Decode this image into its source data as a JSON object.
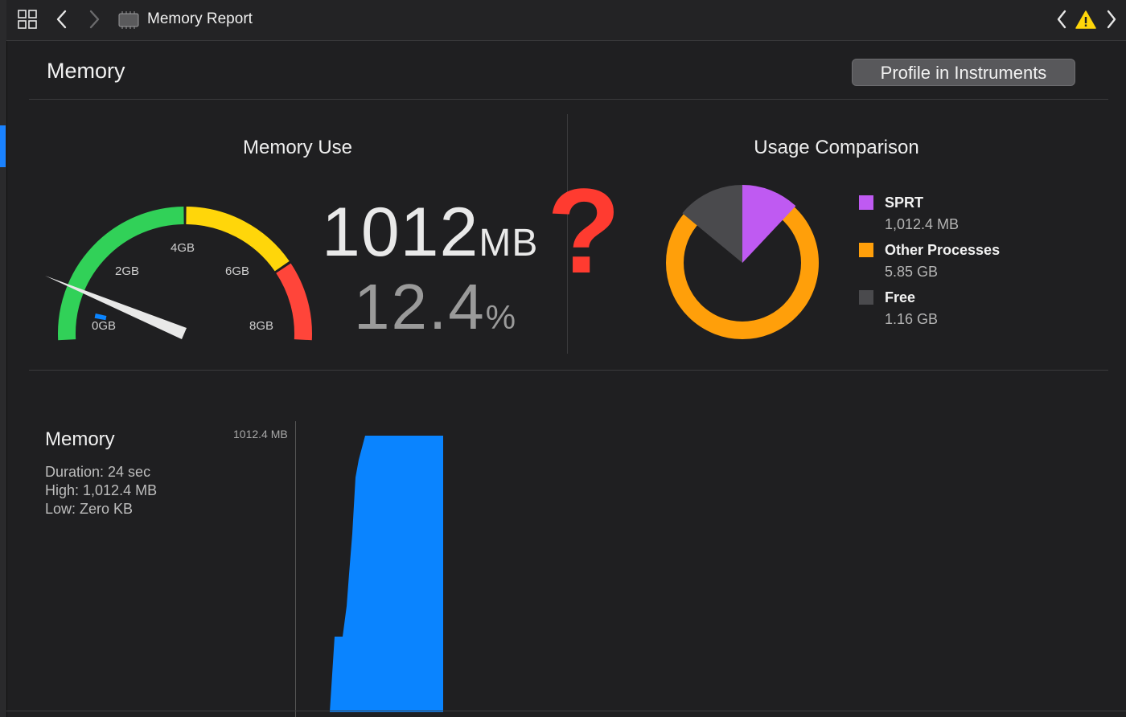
{
  "toolbar": {
    "title": "Memory Report"
  },
  "header": {
    "title": "Memory",
    "profile_button": "Profile in Instruments"
  },
  "memory_use": {
    "heading": "Memory Use",
    "value": "1012",
    "value_unit": "MB",
    "percent": "12.4",
    "percent_unit": "%",
    "gauge": {
      "tick_labels": [
        "0GB",
        "2GB",
        "4GB",
        "6GB",
        "8GB"
      ],
      "max_gb": 8,
      "current_fraction": 0.124,
      "colors": {
        "green": "#31d158",
        "yellow": "#ffd60a",
        "red": "#ff453a",
        "blue": "#0a84ff",
        "needle": "#e8e8e8"
      }
    }
  },
  "overlay": {
    "symbol": "?"
  },
  "usage_comparison": {
    "heading": "Usage Comparison",
    "items": [
      {
        "name": "SPRT",
        "value": "1,012.4 MB",
        "color": "#bf5af2",
        "fraction": 0.12
      },
      {
        "name": "Other Processes",
        "value": "5.85 GB",
        "color": "#ff9f0a",
        "fraction": 0.74
      },
      {
        "name": "Free",
        "value": "1.16 GB",
        "color": "#4a4a4d",
        "fraction": 0.14
      }
    ]
  },
  "timeline": {
    "title": "Memory",
    "duration": "Duration: 24 sec",
    "high": "High: 1,012.4 MB",
    "low": "Low: Zero KB",
    "axis_max_label": "1012.4 MB",
    "bar_color": "#0a84ff"
  }
}
